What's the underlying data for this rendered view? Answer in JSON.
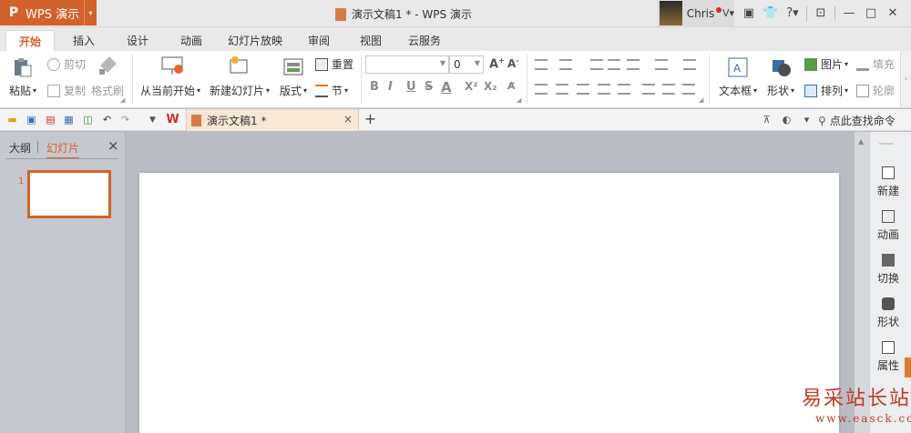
{
  "app": {
    "logo": "P",
    "name": "WPS 演示",
    "drop": "▾"
  },
  "title": "演示文稿1 * - WPS 演示",
  "user": {
    "name": "Chris",
    "drop": "V▾"
  },
  "window_icons": [
    "▣",
    "👕",
    "?▾",
    "⊡",
    "—",
    "□",
    "✕"
  ],
  "tabs": [
    "开始",
    "插入",
    "设计",
    "动画",
    "幻灯片放映",
    "审阅",
    "视图",
    "云服务"
  ],
  "ribbon": {
    "paste": "粘贴",
    "cut": "剪切",
    "copy": "复制",
    "format_painter": "格式刷",
    "from_current": "从当前开始",
    "new_slide": "新建幻灯片",
    "layout": "版式",
    "reset": "重置",
    "section": "节",
    "font_size": "0",
    "textbox": "文本框",
    "shape": "形状",
    "picture": "图片",
    "fill": "填充",
    "arrange": "排列",
    "outline": "轮廓",
    "font_buttons": [
      "B",
      "I",
      "U",
      "S",
      "A",
      "X²",
      "X₂"
    ]
  },
  "quickbar": {
    "doc_tab": "演示文稿1 *",
    "close": "×",
    "add": "+",
    "search": "点此查找命令"
  },
  "leftpane": {
    "outline_tab": "大纲",
    "slides_tab": "幻灯片",
    "close": "×",
    "slide_number": "1"
  },
  "rightpane": [
    "新建",
    "动画",
    "切换",
    "形状",
    "属性"
  ],
  "watermark": {
    "cn": "易采站长站",
    "url": "www.easck.com"
  },
  "colors": {
    "accent": "#d2622a",
    "titlebar": "#e9e9e9",
    "canvas": "#b9bcc3"
  }
}
